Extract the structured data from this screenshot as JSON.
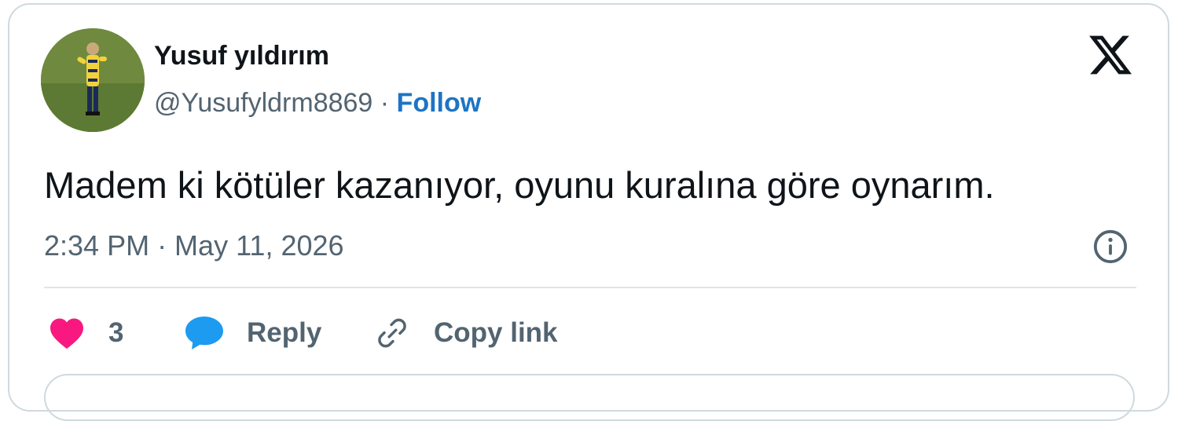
{
  "author": {
    "display_name": "Yusuf yıldırım",
    "handle": "@Yusufyldrm8869",
    "separator": " · ",
    "follow_label": "Follow"
  },
  "tweet": {
    "text": "Madem ki kötüler kazanıyor, oyunu kuralına göre oynarım.",
    "timestamp": "2:34 PM · May 11, 2026"
  },
  "actions": {
    "like_count": "3",
    "reply_label": "Reply",
    "copy_link_label": "Copy link"
  },
  "icons": {
    "logo": "x-logo-icon",
    "info": "info-icon",
    "like": "heart-icon",
    "reply": "speech-bubble-icon",
    "copy": "link-icon"
  },
  "colors": {
    "follow": "#1d74c4",
    "like": "#f91880",
    "reply": "#1d9bf0",
    "text": "#0f1419",
    "muted": "#536471"
  }
}
